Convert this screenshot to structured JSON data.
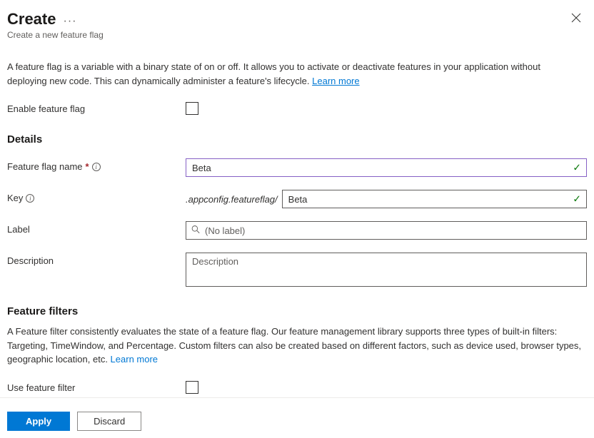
{
  "header": {
    "title": "Create",
    "subtitle": "Create a new feature flag"
  },
  "intro": {
    "text": "A feature flag is a variable with a binary state of on or off. It allows you to activate or deactivate features in your application without deploying new code. This can dynamically administer a feature's lifecycle. ",
    "learn_more": "Learn more"
  },
  "enable": {
    "label": "Enable feature flag"
  },
  "details": {
    "heading": "Details",
    "name": {
      "label": "Feature flag name",
      "value": "Beta"
    },
    "key": {
      "label": "Key",
      "prefix": ".appconfig.featureflag/",
      "value": "Beta"
    },
    "label_field": {
      "label": "Label",
      "placeholder": "(No label)"
    },
    "description": {
      "label": "Description",
      "placeholder": "Description"
    }
  },
  "filters": {
    "heading": "Feature filters",
    "desc": "A Feature filter consistently evaluates the state of a feature flag. Our feature management library supports three types of built-in filters: Targeting, TimeWindow, and Percentage. Custom filters can also be created based on different factors, such as device used, browser types, geographic location, etc. ",
    "learn_more": "Learn more",
    "use_label": "Use feature filter"
  },
  "footer": {
    "apply": "Apply",
    "discard": "Discard"
  }
}
